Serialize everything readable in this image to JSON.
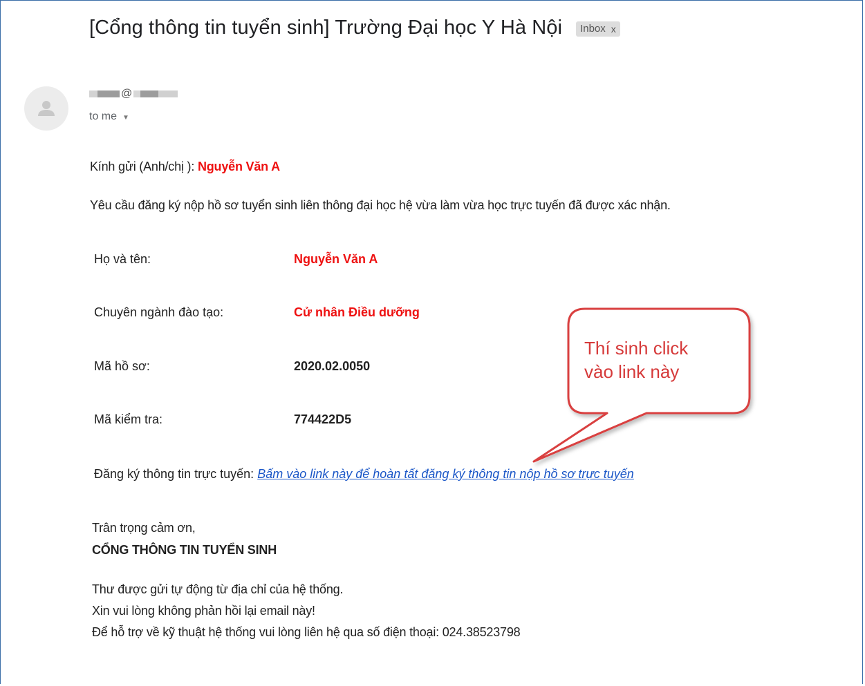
{
  "email": {
    "subject": "[Cổng thông tin tuyển sinh] Trường Đại học Y Hà Nội",
    "label": "Inbox",
    "label_close": "x",
    "sender_at": "@",
    "recipient": "to me",
    "greeting_prefix": "Kính gửi (Anh/chị ):",
    "greeting_name": "Nguyễn Văn A",
    "intro": "Yêu cầu đăng ký nộp hồ sơ tuyển sinh liên thông đại học hệ vừa làm vừa học trực tuyến đã được xác nhận.",
    "details": {
      "name_label": "Họ và tên:",
      "name_value": "Nguyễn Văn A",
      "major_label": "Chuyên ngành đào tạo:",
      "major_value": "Cử nhân Điều dưỡng",
      "file_code_label": "Mã hồ sơ:",
      "file_code_value": "2020.02.0050",
      "check_code_label": "Mã kiểm tra:",
      "check_code_value": "774422D5"
    },
    "register_label": "Đăng ký thông tin trực tuyến:",
    "register_link": "Bấm vào link này để hoàn tất đăng ký thông tin nộp hồ sơ trực tuyến",
    "closing": "Trân trọng cảm ơn,",
    "signature": "CỔNG THÔNG TIN TUYỂN SINH",
    "footer_1": "Thư được gửi tự động từ địa chỉ của hệ thống.",
    "footer_2": "Xin vui lòng không phản hồi lại email này!",
    "footer_3": "Để hỗ trợ về kỹ thuật hệ thống vui lòng liên hệ qua số điện thoại: 024.38523798"
  },
  "annotation": {
    "callout_line_1": "Thí sinh click",
    "callout_line_2": "vào link này",
    "color": "#d63a3a"
  },
  "icons": {
    "avatar": "person-icon",
    "caret": "chevron-down-icon",
    "close": "close-icon"
  }
}
